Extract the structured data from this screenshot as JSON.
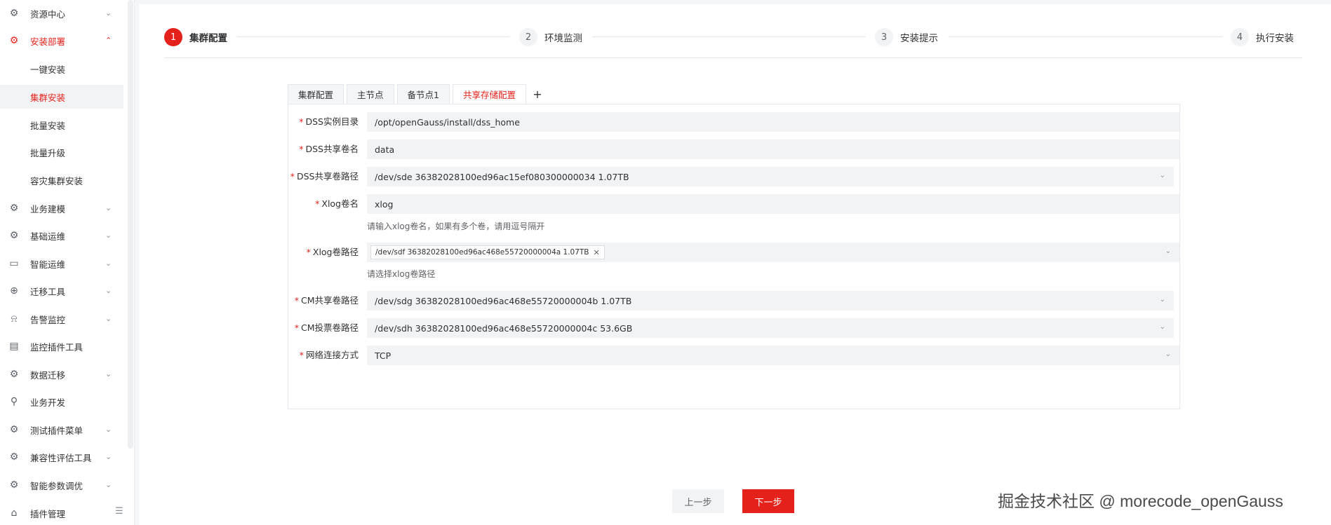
{
  "sidebar": {
    "items": [
      {
        "label": "资源中心",
        "icon": "gear-icon"
      },
      {
        "label": "安装部署",
        "icon": "gear-icon"
      },
      {
        "label": "业务建模",
        "icon": "gear-icon"
      },
      {
        "label": "基础运维",
        "icon": "gear-icon"
      },
      {
        "label": "智能运维",
        "icon": "monitor-icon"
      },
      {
        "label": "迁移工具",
        "icon": "plus-circle-icon"
      },
      {
        "label": "告警监控",
        "icon": "alarm-icon"
      },
      {
        "label": "监控插件工具",
        "icon": "chart-icon"
      },
      {
        "label": "数据迁移",
        "icon": "gear-icon"
      },
      {
        "label": "业务开发",
        "icon": "search-icon"
      },
      {
        "label": "测试插件菜单",
        "icon": "gear-icon"
      },
      {
        "label": "兼容性评估工具",
        "icon": "gear-icon"
      },
      {
        "label": "智能参数调优",
        "icon": "gear-icon"
      },
      {
        "label": "插件管理",
        "icon": "plugin-icon"
      }
    ],
    "sub_items": [
      {
        "label": "一键安装"
      },
      {
        "label": "集群安装"
      },
      {
        "label": "批量安装"
      },
      {
        "label": "批量升级"
      },
      {
        "label": "容灾集群安装"
      }
    ]
  },
  "steps": [
    {
      "num": "1",
      "title": "集群配置"
    },
    {
      "num": "2",
      "title": "环境监测"
    },
    {
      "num": "3",
      "title": "安装提示"
    },
    {
      "num": "4",
      "title": "执行安装"
    }
  ],
  "tabs": [
    {
      "label": "集群配置"
    },
    {
      "label": "主节点"
    },
    {
      "label": "备节点1"
    },
    {
      "label": "共享存储配置"
    }
  ],
  "tab_add_label": "+",
  "form": {
    "required_mark": "*",
    "dss_dir": {
      "label": "DSS实例目录",
      "value": "/opt/openGauss/install/dss_home"
    },
    "dss_vol_name": {
      "label": "DSS共享卷名",
      "value": "data"
    },
    "dss_vol_path": {
      "label": "DSS共享卷路径",
      "value": "/dev/sde 36382028100ed96ac15ef080300000034 1.07TB"
    },
    "xlog_name": {
      "label": "Xlog卷名",
      "value": "xlog",
      "hint": "请输入xlog卷名，如果有多个卷，请用逗号隔开"
    },
    "xlog_path": {
      "label": "Xlog卷路径",
      "tag": "/dev/sdf 36382028100ed96ac468e55720000004a 1.07TB",
      "hint": "请选择xlog卷路径"
    },
    "cm_share_path": {
      "label": "CM共享卷路径",
      "value": "/dev/sdg 36382028100ed96ac468e55720000004b 1.07TB"
    },
    "cm_vote_path": {
      "label": "CM投票卷路径",
      "value": "/dev/sdh 36382028100ed96ac468e55720000004c 53.6GB"
    },
    "network": {
      "label": "网络连接方式",
      "value": "TCP"
    }
  },
  "buttons": {
    "prev": "上一步",
    "next": "下一步"
  },
  "watermark": "掘金技术社区 @ morecode_openGauss",
  "colors": {
    "accent": "#e4221b",
    "field_bg": "#f2f3f5"
  }
}
